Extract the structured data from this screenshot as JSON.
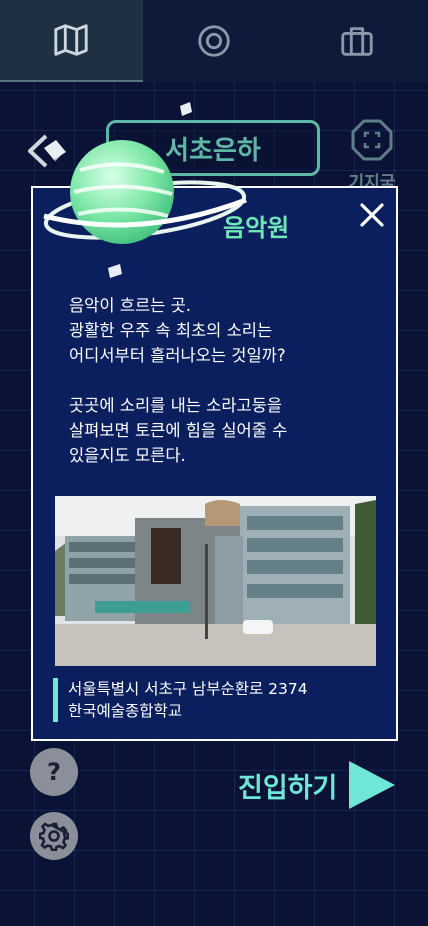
{
  "tabs": [
    {
      "icon": "map-icon",
      "active": true
    },
    {
      "icon": "target-icon",
      "active": false
    },
    {
      "icon": "briefcase-icon",
      "active": false
    }
  ],
  "header": {
    "region_label": "서초은하",
    "base_label": "기지국"
  },
  "popup": {
    "title": "음악원",
    "description": "음악이 흐르는 곳.\n광활한 우주 속 최초의 소리는\n어디서부터 흘러나오는 것일까?\n\n곳곳에 소리를 내는 소라고둥을\n살펴보면 토큰에 힘을 실어줄 수\n있을지도 모른다.",
    "address_line1": "서울특별시 서초구 남부순환로 2374",
    "address_line2": "한국예술종합학교"
  },
  "actions": {
    "help_label": "?",
    "enter_label": "진입하기"
  },
  "colors": {
    "background": "#0a1236",
    "popup_bg": "#0b1f5f",
    "accent_mint": "#6ee7d7",
    "title_green": "#6ee7b4",
    "region_teal": "#5fb7a6"
  }
}
